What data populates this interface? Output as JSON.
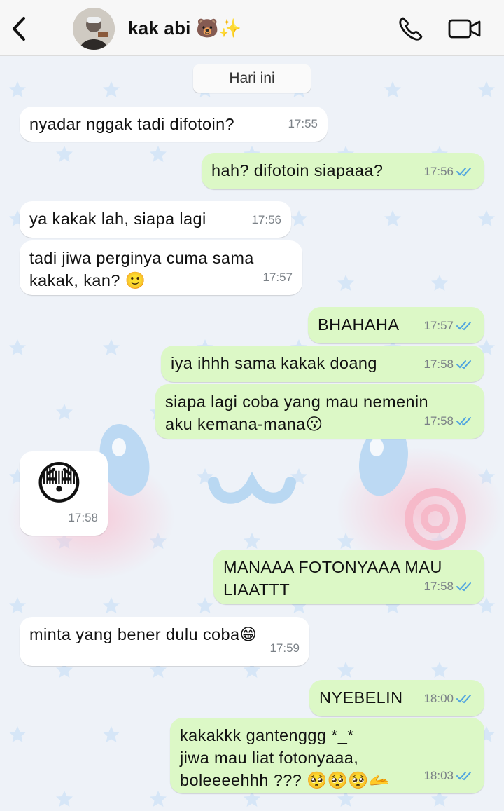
{
  "header": {
    "contact_name": "kak abi 🐻✨",
    "back_icon": "chevron-left-icon",
    "call_icon": "phone-icon",
    "video_icon": "video-camera-icon"
  },
  "date_separator": "Hari ini",
  "messages": [
    {
      "dir": "in",
      "text": "nyadar nggak tadi difotoin?",
      "time": "17:55"
    },
    {
      "dir": "out",
      "text": "hah? difotoin siapaaa?",
      "time": "17:56",
      "status": "read"
    },
    {
      "dir": "in",
      "text": "ya kakak lah, siapa lagi",
      "time": "17:56"
    },
    {
      "dir": "in",
      "text": "tadi jiwa perginya cuma sama\nkakak, kan? 🙂",
      "time": "17:57"
    },
    {
      "dir": "out",
      "text": "BHAHAHA",
      "time": "17:57",
      "status": "read"
    },
    {
      "dir": "out",
      "text": "iya ihhh sama kakak doang",
      "time": "17:58",
      "status": "read"
    },
    {
      "dir": "out",
      "text": "siapa lagi coba yang mau nemenin\naku kemana-mana😗",
      "time": "17:58",
      "status": "read"
    },
    {
      "dir": "in",
      "text": "😳",
      "time": "17:58",
      "sticker": true
    },
    {
      "dir": "out",
      "text": "MANAAA FOTONYAAA MAU\nLIAATTT",
      "time": "17:58",
      "status": "read"
    },
    {
      "dir": "in",
      "text": "minta yang bener dulu coba😁",
      "time": "17:59"
    },
    {
      "dir": "out",
      "text": "NYEBELIN",
      "time": "18:00",
      "status": "read"
    },
    {
      "dir": "out",
      "text": "kakakkk gantenggg *_*\njiwa mau liat fotonyaaa,\nboleeeehhh ??? 🥺🥺🥺🫴",
      "time": "18:03",
      "status": "read"
    }
  ],
  "colors": {
    "outgoing_bubble": "#dcf8c6",
    "incoming_bubble": "#ffffff",
    "read_ticks": "#4fa3e0",
    "wallpaper": "#eef2f8"
  }
}
